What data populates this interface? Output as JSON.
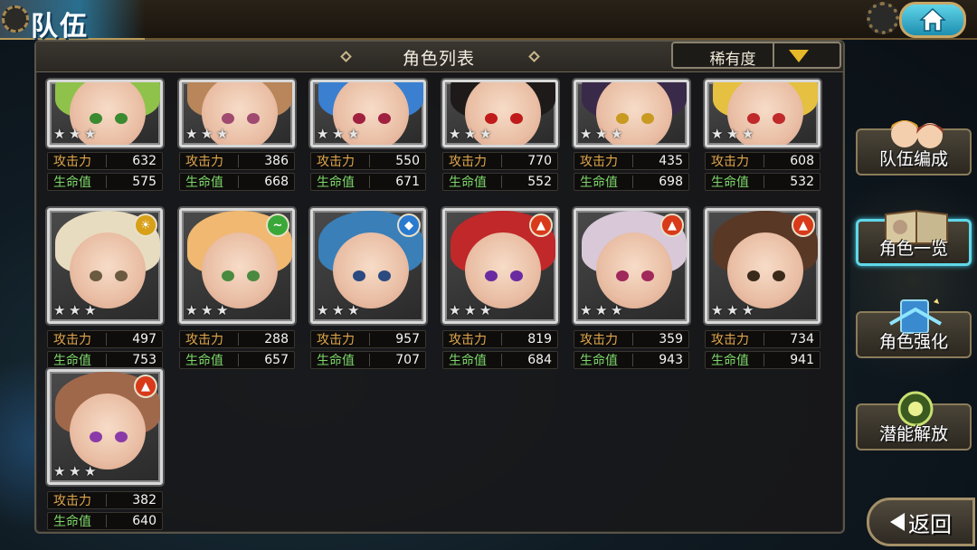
{
  "header": {
    "title": "队伍"
  },
  "panel": {
    "title": "角色列表"
  },
  "sort": {
    "label": "稀有度"
  },
  "stat_labels": {
    "atk": "攻击力",
    "hp": "生命值"
  },
  "characters": [
    {
      "atk": "632",
      "hp": "575",
      "stars": 3,
      "element": "",
      "hair": "#8fc24a",
      "eye": "#3a8a30"
    },
    {
      "atk": "386",
      "hp": "668",
      "stars": 3,
      "element": "",
      "hair": "#b8865a",
      "eye": "#a04a70"
    },
    {
      "atk": "550",
      "hp": "671",
      "stars": 3,
      "element": "",
      "hair": "#3a7fd0",
      "eye": "#a02040"
    },
    {
      "atk": "770",
      "hp": "552",
      "stars": 3,
      "element": "",
      "hair": "#1e1a1a",
      "eye": "#c01a1a"
    },
    {
      "atk": "435",
      "hp": "698",
      "stars": 3,
      "element": "",
      "hair": "#3a2a4a",
      "eye": "#c89a20"
    },
    {
      "atk": "608",
      "hp": "532",
      "stars": 3,
      "element": "",
      "hair": "#e6c040",
      "eye": "#c02a2a"
    },
    {
      "atk": "497",
      "hp": "753",
      "stars": 3,
      "element": "light",
      "hair": "#e8dcc0",
      "eye": "#6a5a40"
    },
    {
      "atk": "288",
      "hp": "657",
      "stars": 3,
      "element": "wind",
      "hair": "#f0b870",
      "eye": "#4a8a40"
    },
    {
      "atk": "957",
      "hp": "707",
      "stars": 3,
      "element": "water",
      "hair": "#3a7fb8",
      "eye": "#2a4a80"
    },
    {
      "atk": "819",
      "hp": "684",
      "stars": 3,
      "element": "fire",
      "hair": "#c0282a",
      "eye": "#6a2aa0"
    },
    {
      "atk": "359",
      "hp": "943",
      "stars": 3,
      "element": "fire",
      "hair": "#d8c8d8",
      "eye": "#a0285a"
    },
    {
      "atk": "734",
      "hp": "941",
      "stars": 3,
      "element": "fire",
      "hair": "#5a3826",
      "eye": "#3a2a1a"
    },
    {
      "atk": "382",
      "hp": "640",
      "stars": 3,
      "element": "fire",
      "hair": "#a0684a",
      "eye": "#8a3aa8"
    }
  ],
  "side_menu": [
    {
      "label": "队伍编成",
      "icon": "team-icon"
    },
    {
      "label": "角色一览",
      "icon": "book-icon",
      "active": true
    },
    {
      "label": "角色强化",
      "icon": "enhance-icon"
    },
    {
      "label": "潜能解放",
      "icon": "potential-icon"
    }
  ],
  "back": {
    "label": "返回"
  },
  "colors": {
    "accent": "#5fd8e8",
    "atk_label": "#e2a74c",
    "hp_label": "#7ed86a",
    "sort_arrow": "#e7b928",
    "element_light": "#d8a018",
    "element_wind": "#3aa838",
    "element_water": "#2a7ad0",
    "element_fire": "#d83a1a"
  }
}
